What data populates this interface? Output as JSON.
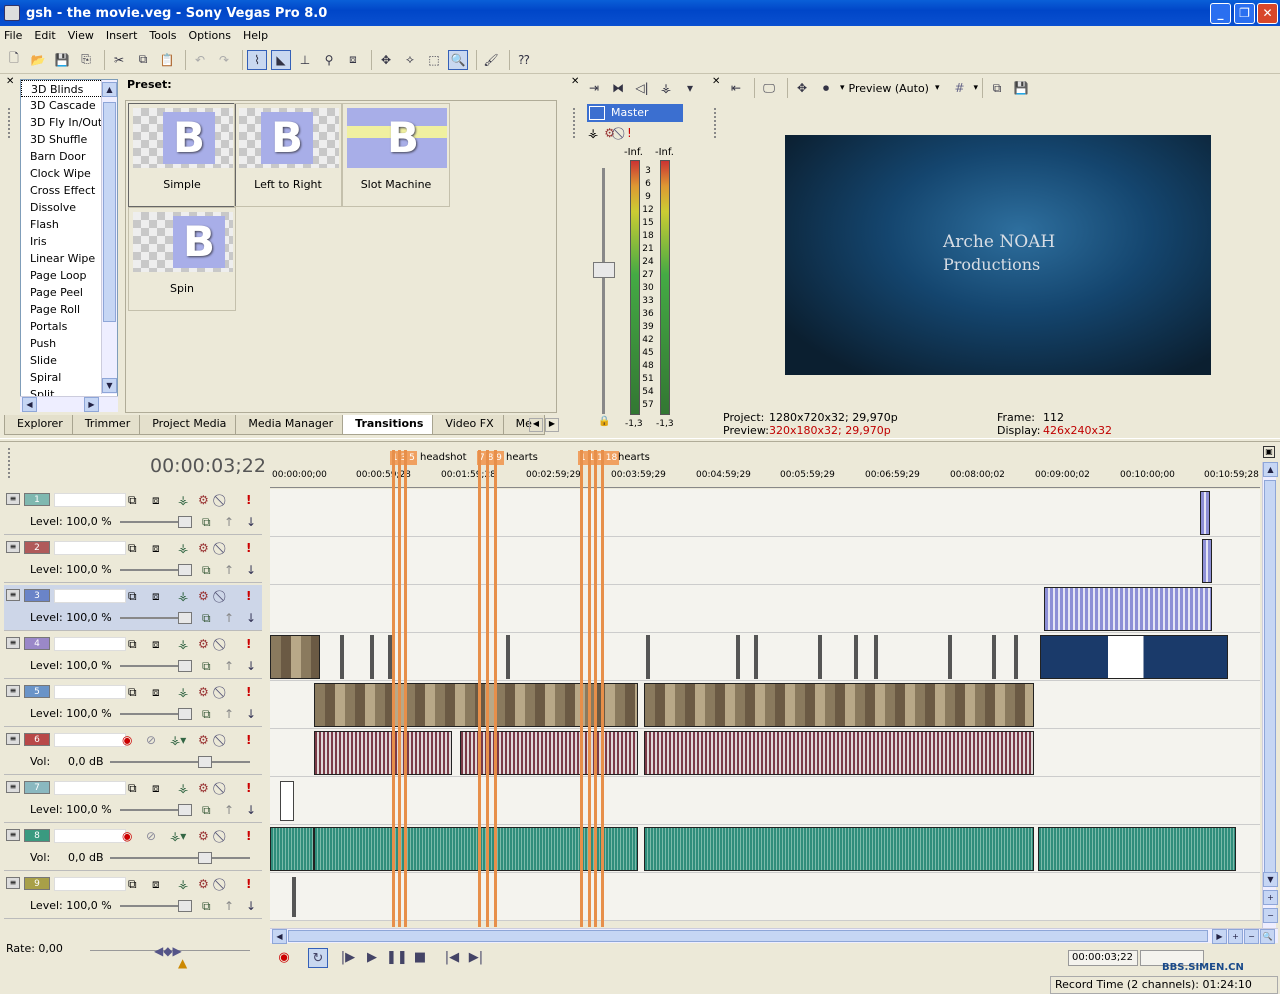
{
  "window": {
    "title": "gsh - the movie.veg - Sony Vegas Pro 8.0"
  },
  "menu": [
    "File",
    "Edit",
    "View",
    "Insert",
    "Tools",
    "Options",
    "Help"
  ],
  "transitions": {
    "preset_label": "Preset:",
    "list": [
      "3D Blinds",
      "3D Cascade",
      "3D Fly In/Out",
      "3D Shuffle",
      "Barn Door",
      "Clock Wipe",
      "Cross Effect",
      "Dissolve",
      "Flash",
      "Iris",
      "Linear Wipe",
      "Page Loop",
      "Page Peel",
      "Page Roll",
      "Portals",
      "Push",
      "Slide",
      "Spiral",
      "Split"
    ],
    "presets": [
      "Simple",
      "Left to Right",
      "Slot Machine",
      "Spin"
    ]
  },
  "tabs": [
    "Explorer",
    "Trimmer",
    "Project Media",
    "Media Manager",
    "Transitions",
    "Video FX",
    "Me"
  ],
  "mixer": {
    "master": "Master",
    "peak_left": "-Inf.",
    "peak_right": "-Inf.",
    "scale": [
      "3",
      "6",
      "9",
      "12",
      "15",
      "18",
      "21",
      "24",
      "27",
      "30",
      "33",
      "36",
      "39",
      "42",
      "45",
      "48",
      "51",
      "54",
      "57"
    ],
    "bottom_left": "-1,3",
    "bottom_right": "-1,3"
  },
  "preview": {
    "mode": "Preview (Auto)",
    "overlay_line1": "Arche NOAH",
    "overlay_line2": "Productions",
    "project_label": "Project:",
    "project_value": "1280x720x32; 29,970p",
    "preview_label": "Preview:",
    "preview_value": "320x180x32; 29,970p",
    "frame_label": "Frame:",
    "frame_value": "112",
    "display_label": "Display:",
    "display_value": "426x240x32",
    "colors": {
      "preview_value": "#c00000"
    }
  },
  "timeline": {
    "timecode": "00:00:03;22",
    "ruler": [
      "00:00:00;00",
      "00:00:59;28",
      "00:01:59;28",
      "00:02:59;29",
      "00:03:59;29",
      "00:04:59;29",
      "00:05:59;29",
      "00:06:59;29",
      "00:08:00;02",
      "00:09:00;02",
      "00:10:00;00",
      "00:10:59;28"
    ],
    "markers": [
      {
        "nums": "1 3 5",
        "text": "headshot"
      },
      {
        "nums": "7 8 9",
        "text": "hearts"
      },
      {
        "nums": "1 1 1 18",
        "text": "hearts"
      }
    ],
    "tracks": [
      {
        "num": "1",
        "type": "video",
        "label": "Level: 100,0 %",
        "color": "#7fb8b0"
      },
      {
        "num": "2",
        "type": "video",
        "label": "Level: 100,0 %",
        "color": "#b05a5a"
      },
      {
        "num": "3",
        "type": "video",
        "label": "Level: 100,0 %",
        "color": "#6a84c8"
      },
      {
        "num": "4",
        "type": "video",
        "label": "Level: 100,0 %",
        "color": "#9a88c8"
      },
      {
        "num": "5",
        "type": "video",
        "label": "Level: 100,0 %",
        "color": "#6a94c8"
      },
      {
        "num": "6",
        "type": "audio",
        "label": "Vol:",
        "value": "0,0 dB",
        "color": "#b84848"
      },
      {
        "num": "7",
        "type": "video",
        "label": "Level: 100,0 %",
        "color": "#8ab8c0"
      },
      {
        "num": "8",
        "type": "audio",
        "label": "Vol:",
        "value": "0,0 dB",
        "color": "#3a9a80"
      },
      {
        "num": "9",
        "type": "video",
        "label": "Level: 100,0 %",
        "color": "#a8a048"
      }
    ]
  },
  "footer": {
    "rate": "Rate: 0,00",
    "timecode": "00:00:03;22",
    "record_time": "Record Time (2 channels): 01:24:10",
    "watermark": "BBS.SIMEN.CN"
  }
}
